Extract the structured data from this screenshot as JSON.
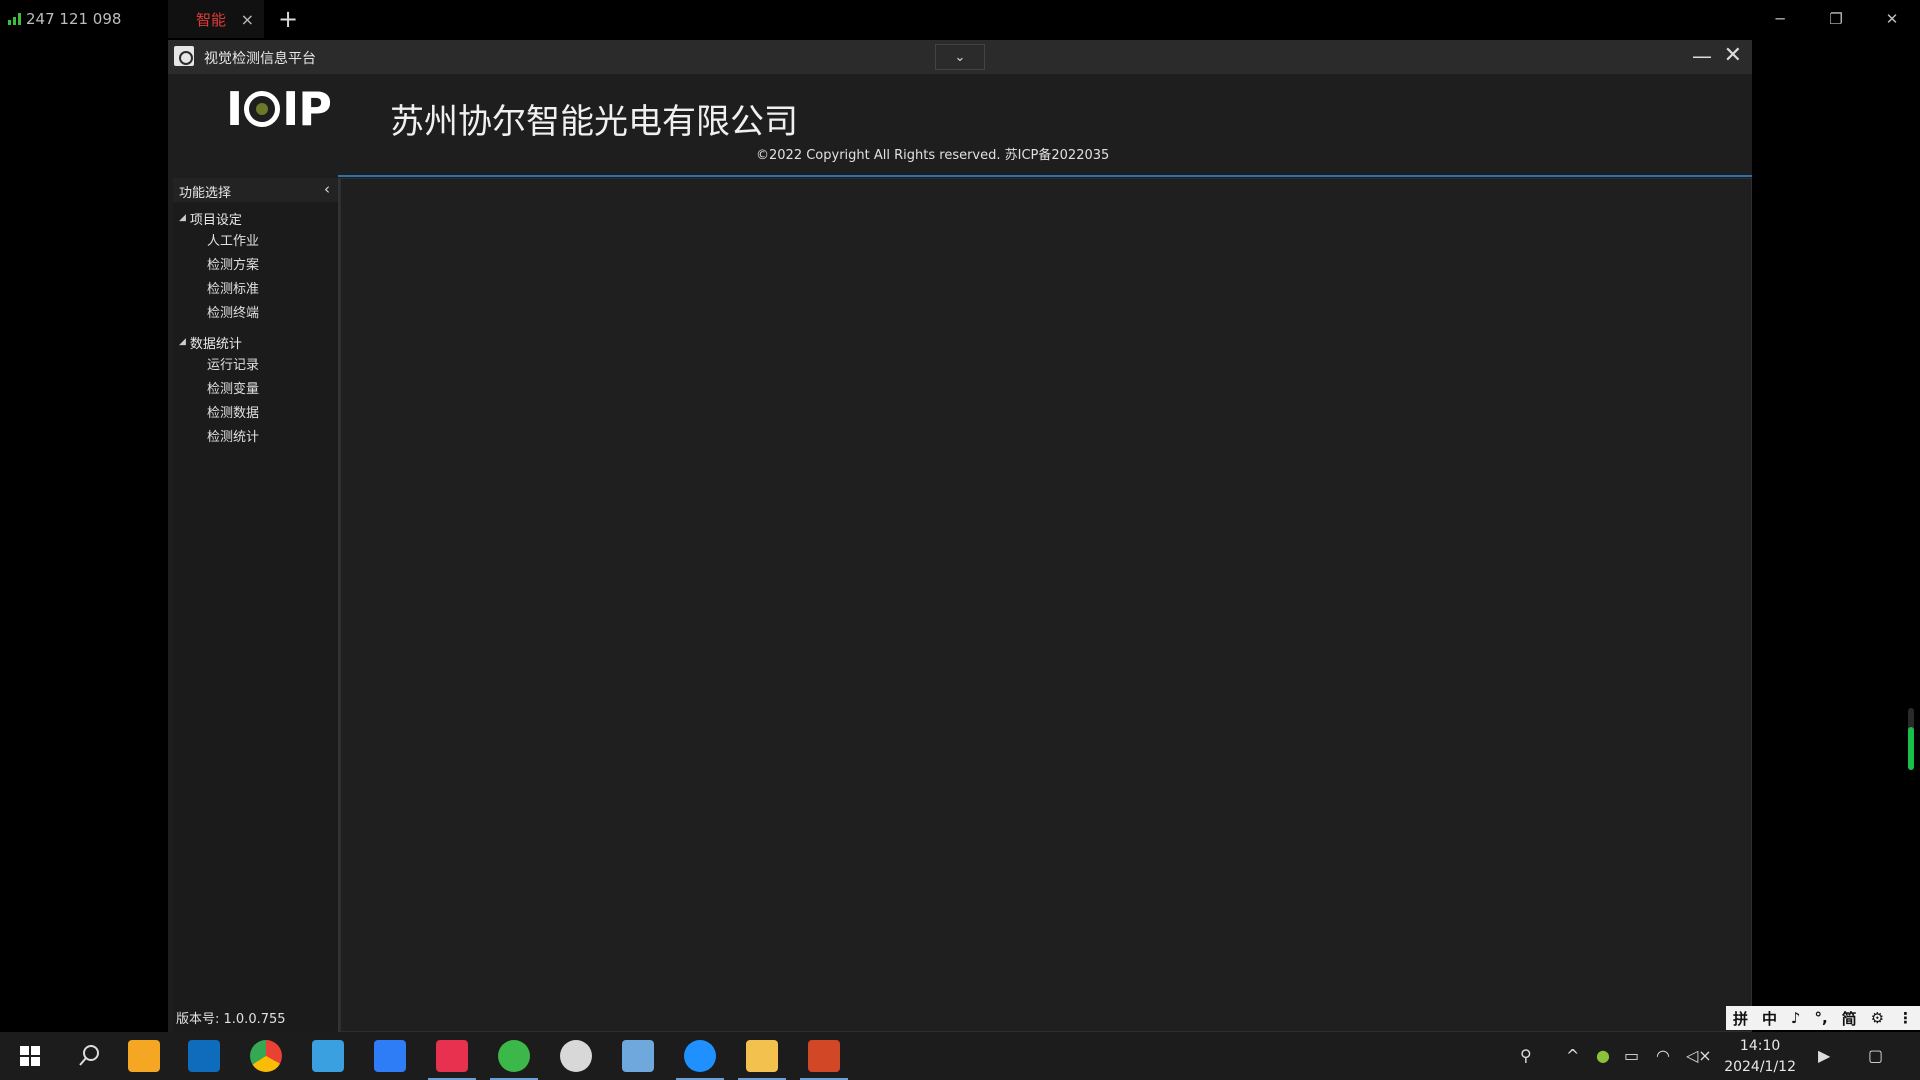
{
  "remote_tabs": {
    "connection_id": "247 121 098",
    "active_tab_label": "智能",
    "close_glyph": "×",
    "add_glyph": "+"
  },
  "remote_window_controls": {
    "minimize": "─",
    "restore": "❐",
    "close": "✕"
  },
  "app": {
    "title": "视觉检测信息平台",
    "dropdown_glyph": "⌄",
    "minimize_glyph": "—",
    "close_glyph": "✕"
  },
  "header": {
    "logo_left": "I",
    "logo_right": "IP",
    "company": "苏州协尔智能光电有限公司",
    "copyright": "©2022 Copyright All Rights reserved.  苏ICP备2022035"
  },
  "sidebar": {
    "title": "功能选择",
    "collapse_glyph": "‹",
    "groups": [
      {
        "label": "项目设定",
        "items": [
          "人工作业",
          "检测方案",
          "检测标准",
          "检测终端"
        ]
      },
      {
        "label": "数据统计",
        "items": [
          "运行记录",
          "检测变量",
          "检测数据",
          "检测统计"
        ]
      }
    ]
  },
  "status": {
    "version": "版本号: 1.0.0.755"
  },
  "ime": {
    "items": [
      "拼",
      "中",
      "♪",
      "°,",
      "简",
      "⚙",
      "⋮"
    ]
  },
  "taskbar": {
    "time": "14:10",
    "date": "2024/1/12",
    "icons": [
      "windows-start-icon",
      "search-icon",
      "app-star-icon",
      "outlook-icon",
      "chrome-icon",
      "remote-app-icon",
      "cloud-app-icon",
      "active-app-icon",
      "browser-e-icon",
      "paint-icon",
      "pen-icon",
      "chat-search-icon",
      "file-explorer-icon",
      "office-icon"
    ],
    "colors": {
      "start": "#ffffff",
      "star": "#f5a623",
      "outlook": "#0f6cbd",
      "chrome": "#e94235",
      "remote": "#3aa0e0",
      "cloud": "#2f7df6",
      "active": "#e8304f",
      "browser_e": "#3cb84a",
      "paint": "#d8d8d8",
      "pen": "#6fa8dc",
      "chat": "#1e90ff",
      "explorer": "#f2c14e",
      "office": "#d24726"
    }
  },
  "gauge": {
    "level": 0.7
  }
}
